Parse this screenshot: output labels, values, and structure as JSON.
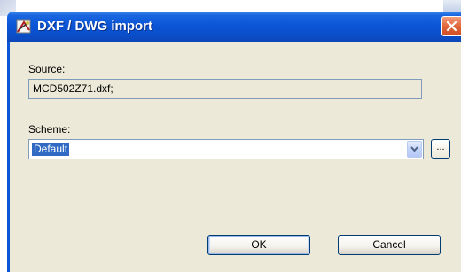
{
  "window": {
    "title": "DXF / DWG import",
    "app_icon": "cad-import-icon",
    "close_icon": "close-icon"
  },
  "source": {
    "label": "Source:",
    "value": "MCD502Z71.dxf;"
  },
  "scheme": {
    "label": "Scheme:",
    "selected": "Default",
    "dropdown_icon": "chevron-down-icon",
    "browse_label": "..."
  },
  "buttons": {
    "ok_label": "OK",
    "cancel_label": "Cancel"
  },
  "colors": {
    "titlebar": "#0b55d7",
    "close": "#e2663b",
    "dialog_bg": "#ece9d8",
    "selection": "#316ac5"
  }
}
